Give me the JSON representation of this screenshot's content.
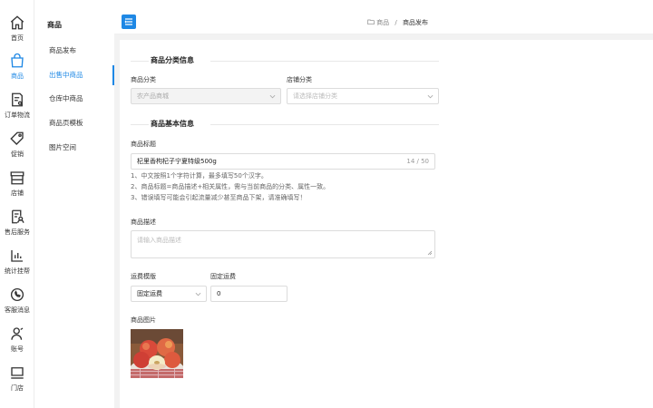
{
  "rail": {
    "items": [
      {
        "label": "首页",
        "icon": "home-icon"
      },
      {
        "label": "商品",
        "icon": "shopping-bag-icon",
        "active": true
      },
      {
        "label": "订单物流",
        "icon": "order-document-icon"
      },
      {
        "label": "促销",
        "icon": "price-tag-icon"
      },
      {
        "label": "店铺",
        "icon": "store-icon"
      },
      {
        "label": "售后服务",
        "icon": "after-sales-icon"
      },
      {
        "label": "统计挂帮",
        "icon": "bar-chart-icon"
      },
      {
        "label": "客服消息",
        "icon": "chat-icon"
      },
      {
        "label": "账号",
        "icon": "user-icon"
      },
      {
        "label": "门店",
        "icon": "monitor-icon"
      }
    ],
    "accent": "#1e88e5"
  },
  "subnav": {
    "title": "商品",
    "items": [
      {
        "label": "商品发布"
      },
      {
        "label": "出售中商品",
        "active": true
      },
      {
        "label": "仓库中商品"
      },
      {
        "label": "商品页模板"
      },
      {
        "label": "图片空间"
      }
    ]
  },
  "breadcrumb": {
    "parent": "商品",
    "separator": "/",
    "current": "商品发布"
  },
  "form": {
    "category_section": "商品分类信息",
    "category_label": "商品分类",
    "category_value": "农产品商城",
    "store_category_label": "店铺分类",
    "store_category_placeholder": "请选择店铺分类",
    "basic_section": "商品基本信息",
    "title_label": "商品标题",
    "title_value": "杞里香枸杞子宁夏特级500g",
    "title_counter": "14 / 50",
    "hints": [
      "1、中文按照1个字符计算，最多填写50个汉字。",
      "2、商品标题=商品描述+相关属性，需与当前商品的分类、属性一致。",
      "3、错误填写可能会引起流量减少甚至商品下架，请准确填写！"
    ],
    "desc_label": "商品描述",
    "desc_placeholder": "请输入商品描述",
    "shipping_template_label": "运费模版",
    "shipping_template_value": "固定运费",
    "fixed_shipping_label": "固定运费",
    "fixed_shipping_value": "0",
    "images_label": "商品图片"
  }
}
